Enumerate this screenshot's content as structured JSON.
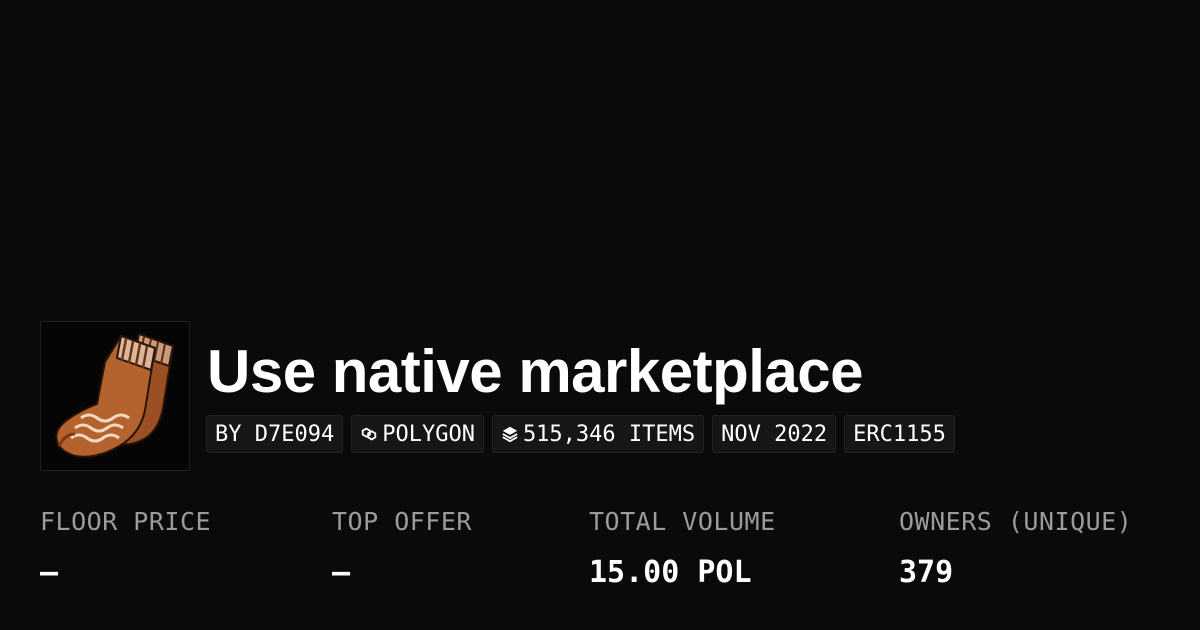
{
  "collection": {
    "title": "Use native marketplace",
    "avatar_icon": "sock-icon"
  },
  "tags": {
    "creator": "BY D7E094",
    "chain": "POLYGON",
    "chain_icon": "polygon-icon",
    "items": "515,346 ITEMS",
    "items_icon": "layers-icon",
    "date": "NOV 2022",
    "standard": "ERC1155"
  },
  "stats": {
    "floor_price": {
      "label": "FLOOR PRICE",
      "value": "–"
    },
    "top_offer": {
      "label": "TOP OFFER",
      "value": "–"
    },
    "total_volume": {
      "label": "TOTAL VOLUME",
      "value": "15.00 POL"
    },
    "owners": {
      "label": "OWNERS (UNIQUE)",
      "value": "379"
    }
  },
  "colors": {
    "background": "#0a0a0a",
    "text": "#ffffff",
    "muted_label": "#9b9b9b",
    "tag_bg": "#161616",
    "sock_orange": "#b5632e"
  }
}
